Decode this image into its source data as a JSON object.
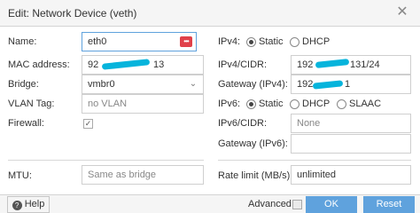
{
  "window": {
    "title": "Edit: Network Device (veth)"
  },
  "left": {
    "name": {
      "label": "Name:",
      "value": "eth0"
    },
    "mac": {
      "label": "MAC address:",
      "value_start": "92",
      "value_end": "13"
    },
    "bridge": {
      "label": "Bridge:",
      "value": "vmbr0"
    },
    "vlan": {
      "label": "VLAN Tag:",
      "placeholder": "no VLAN"
    },
    "firewall": {
      "label": "Firewall:",
      "checked": true
    },
    "mtu": {
      "label": "MTU:",
      "placeholder": "Same as bridge"
    }
  },
  "right": {
    "ipv4": {
      "label": "IPv4:",
      "options": [
        "Static",
        "DHCP"
      ],
      "selected": "Static"
    },
    "ipv4_cidr": {
      "label": "IPv4/CIDR:",
      "value_start": "192",
      "value_end": "131/24"
    },
    "gateway4": {
      "label": "Gateway (IPv4):",
      "value_start": "192",
      "value_end": "1"
    },
    "ipv6": {
      "label": "IPv6:",
      "options": [
        "Static",
        "DHCP",
        "SLAAC"
      ],
      "selected": "Static"
    },
    "ipv6_cidr": {
      "label": "IPv6/CIDR:",
      "value": "None"
    },
    "gateway6": {
      "label": "Gateway (IPv6):",
      "value": ""
    },
    "rate_limit": {
      "label": "Rate limit (MB/s):",
      "placeholder": "unlimited"
    }
  },
  "footer": {
    "help": "Help",
    "advanced": "Advanced",
    "ok": "OK",
    "reset": "Reset"
  },
  "colors": {
    "accent": "#5fa2dd",
    "redaction": "#06b4dc",
    "password_icon": "#e0414a"
  },
  "icons": {
    "close": "close-icon",
    "password": "password-manager-icon",
    "dropdown": "chevron-down-icon",
    "help": "help-icon"
  }
}
